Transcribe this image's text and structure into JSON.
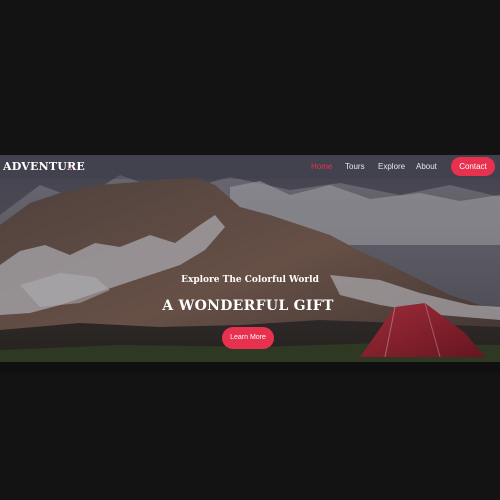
{
  "brand": {
    "name": "ADVENTURE",
    "accent_dot": "."
  },
  "nav": {
    "links": [
      {
        "label": "Home",
        "active": true
      },
      {
        "label": "Tours",
        "active": false
      },
      {
        "label": "Explore",
        "active": false
      },
      {
        "label": "About",
        "active": false
      }
    ],
    "contact_label": "Contact"
  },
  "hero": {
    "subtitle": "Explore The Colorful World",
    "headline": "A WONDERFUL GIFT",
    "cta_label": "Learn More"
  },
  "colors": {
    "accent": "#e8314f",
    "page_background": "#131314",
    "text": "#ffffff"
  }
}
